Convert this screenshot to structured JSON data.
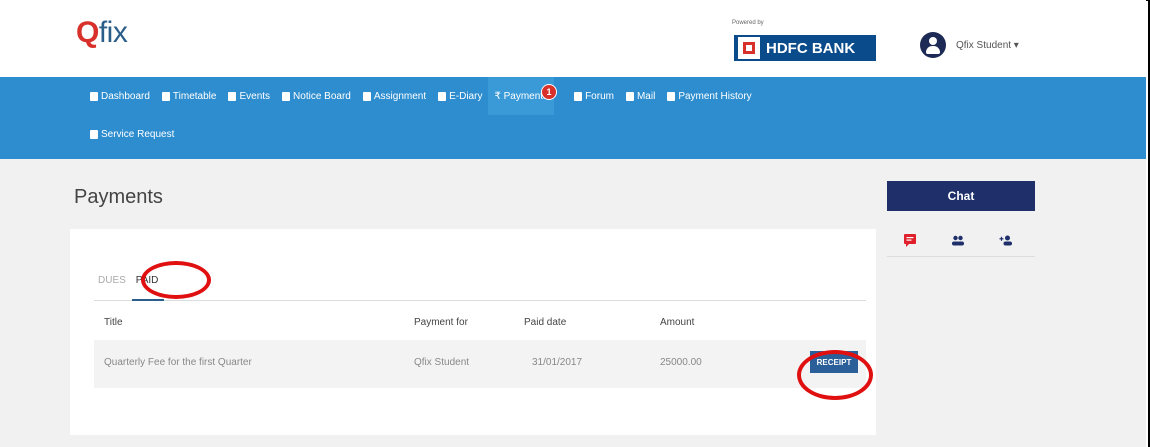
{
  "header": {
    "logo_prefix": "Q",
    "logo_text": "fix",
    "powered_by": "Powered by",
    "bank_name": "HDFC BANK",
    "user_name": "Qfix Student ▾"
  },
  "nav": {
    "items": [
      {
        "label": "Dashboard",
        "icon": "home-icon"
      },
      {
        "label": "Timetable",
        "icon": "calendar-icon"
      },
      {
        "label": "Events",
        "icon": "calendar-icon"
      },
      {
        "label": "Notice Board",
        "icon": "bell-icon"
      },
      {
        "label": "Assignment",
        "icon": "edit-icon"
      },
      {
        "label": "E-Diary",
        "icon": "book-icon"
      },
      {
        "label": "₹ Payments",
        "icon": "rupee-icon",
        "badge": "1",
        "active": true
      },
      {
        "label": "Forum",
        "icon": "forum-icon"
      },
      {
        "label": "Mail",
        "icon": "mail-icon"
      },
      {
        "label": "Payment History",
        "icon": "list-icon"
      }
    ],
    "row2": [
      {
        "label": "Service Request",
        "icon": "list-icon"
      }
    ]
  },
  "page": {
    "title": "Payments",
    "tabs": [
      "DUES",
      "PAID"
    ],
    "active_tab": "PAID",
    "columns": [
      "Title",
      "Payment for",
      "Paid date",
      "Amount"
    ],
    "rows": [
      {
        "title": "Quarterly Fee for the first Quarter",
        "payment_for": "Qfix Student",
        "paid_date": "31/01/2017",
        "amount": "25000.00",
        "action": "RECEIPT"
      }
    ]
  },
  "chat": {
    "title": "Chat",
    "icons": [
      "chat-bubble-icon",
      "group-icon",
      "add-person-icon"
    ]
  },
  "colors": {
    "nav_bg": "#2e8dcf",
    "chat_header": "#1e2f6a",
    "highlight_ring": "#e01010",
    "badge": "#d8312b"
  }
}
